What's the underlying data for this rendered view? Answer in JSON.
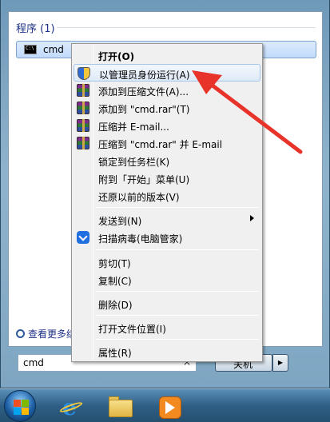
{
  "start_menu": {
    "section_title": "程序 (1)",
    "program_label": "cmd",
    "more_results": "查看更多结果",
    "search": {
      "value": "cmd",
      "clear": "×"
    },
    "shutdown_label": "关机",
    "shutdown_arrow": "▶"
  },
  "context_menu": {
    "items": [
      {
        "label": "打开(O)"
      },
      {
        "label": "以管理员身份运行(A)"
      },
      {
        "label": "添加到压缩文件(A)..."
      },
      {
        "label": "添加到 \"cmd.rar\"(T)"
      },
      {
        "label": "压缩并 E-mail..."
      },
      {
        "label": "压缩到 \"cmd.rar\" 并 E-mail"
      },
      {
        "label": "锁定到任务栏(K)"
      },
      {
        "label": "附到「开始」菜单(U)"
      },
      {
        "label": "还原以前的版本(V)"
      },
      {
        "label": "发送到(N)"
      },
      {
        "label": "扫描病毒(电脑管家)"
      },
      {
        "label": "剪切(T)"
      },
      {
        "label": "复制(C)"
      },
      {
        "label": "删除(D)"
      },
      {
        "label": "打开文件位置(I)"
      },
      {
        "label": "属性(R)"
      }
    ]
  },
  "colors": {
    "arrow": "#e8332a",
    "highlight": "#dfeaf8",
    "link": "#1e3287"
  }
}
